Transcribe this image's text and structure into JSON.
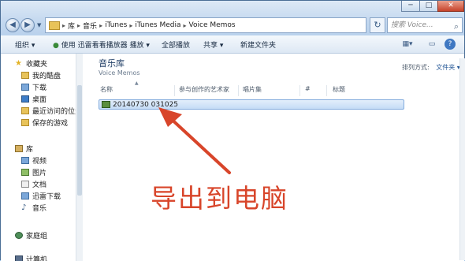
{
  "breadcrumb": [
    "库",
    "音乐",
    "iTunes",
    "iTunes Media",
    "Voice Memos"
  ],
  "search": {
    "placeholder": "搜索 Voice..."
  },
  "toolbar": {
    "organize": "组织 ▾",
    "play_with": "使用 迅雷看看播放器 播放 ▾",
    "play_all": "全部播放",
    "share": "共享 ▾",
    "new_folder": "新建文件夹"
  },
  "nav": {
    "favorites": "收藏夹",
    "items_fav": [
      "我的酷盘",
      "下载",
      "桌面",
      "最近访问的位置",
      "保存的游戏"
    ],
    "libraries": "库",
    "items_lib": [
      "视频",
      "图片",
      "文档",
      "迅雷下载",
      "音乐"
    ],
    "homegroup": "家庭组",
    "computer": "计算机"
  },
  "content": {
    "library_title": "音乐库",
    "library_sub": "Voice Memos",
    "arrange_label": "排列方式:",
    "arrange_value": "文件夹 ▾",
    "columns": [
      "名称",
      "参与创作的艺术家",
      "唱片集",
      "#",
      "标题"
    ],
    "file": "20140730 031025"
  },
  "caption": "导出到电脑",
  "colors": {
    "caption": "#d8452a",
    "selection": "#c5dcf6"
  }
}
